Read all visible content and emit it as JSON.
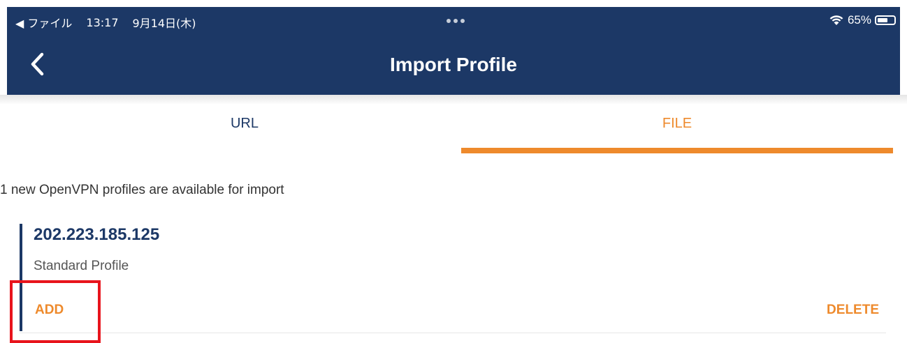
{
  "status_bar": {
    "back_label": "◀ ファイル",
    "time": "13:17",
    "date": "9月14日(木)",
    "battery": "65%",
    "battery_level": 0.65,
    "icons": [
      "back-arrow-icon",
      "more-dots-icon",
      "wifi-icon",
      "battery-icon"
    ]
  },
  "nav": {
    "title": "Import Profile",
    "back_icon": "chevron-left-icon"
  },
  "tabs": [
    {
      "label": "URL",
      "selected": false
    },
    {
      "label": "FILE",
      "selected": true
    }
  ],
  "main": {
    "available_text": "1 new OpenVPN profiles are available for import"
  },
  "profiles": [
    {
      "name": "202.223.185.125",
      "type": "Standard Profile",
      "add_label": "ADD",
      "delete_label": "DELETE"
    }
  ],
  "colors": {
    "header": "#1c3866",
    "accent": "#ee8a2c",
    "highlight": "#e8141c"
  }
}
